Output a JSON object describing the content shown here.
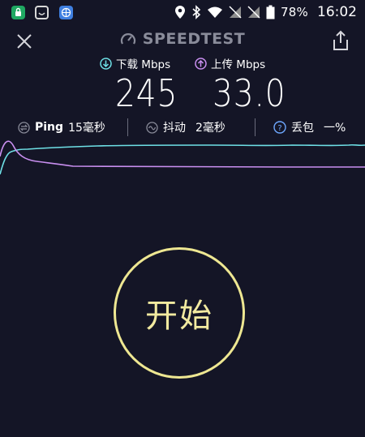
{
  "status_bar": {
    "battery_percent": "78%",
    "time": "16:02",
    "colors": {
      "app1": "#1fa862",
      "app3": "#3f7fe0"
    }
  },
  "header": {
    "brand": "SPEEDTEST",
    "close_icon": "close-icon",
    "share_icon": "share-icon"
  },
  "download": {
    "label": "下载 Mbps",
    "value": "245",
    "color": "#6ee0e6"
  },
  "upload": {
    "label": "上传 Mbps",
    "value": "33.0",
    "color": "#c98ff0"
  },
  "stats": {
    "ping_label": "Ping",
    "ping_value": "15毫秒",
    "jitter_label": "抖动",
    "jitter_value": "2毫秒",
    "loss_label": "丢包",
    "loss_value": "一%"
  },
  "start_button": {
    "label": "开始",
    "color": "#eee792"
  }
}
